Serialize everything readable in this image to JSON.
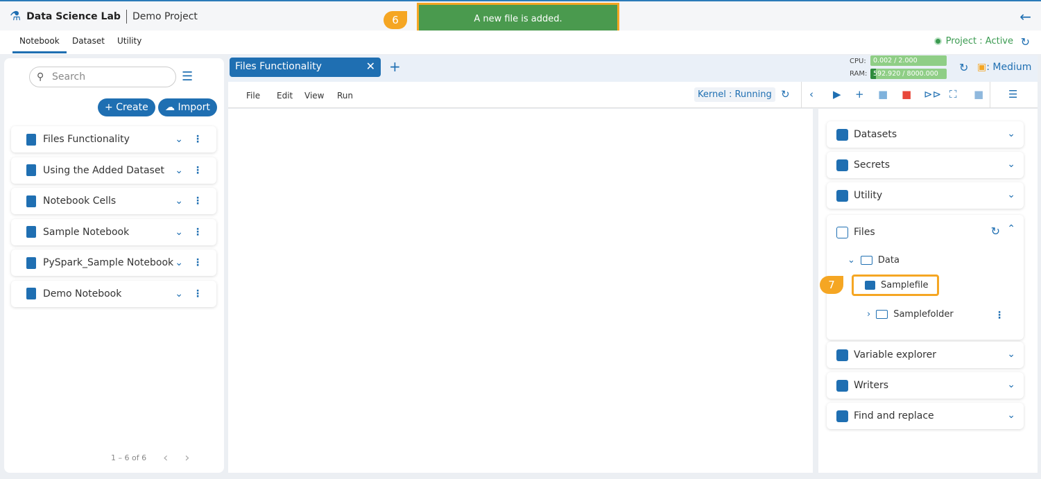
{
  "header": {
    "app": "Data Science Lab",
    "project": "Demo Project"
  },
  "nav": {
    "tabs": [
      "Notebook",
      "Dataset",
      "Utility"
    ],
    "status": "Project : Active"
  },
  "toast": {
    "message": "A new file is added.",
    "step": "6"
  },
  "sidebar": {
    "search_placeholder": "Search",
    "create": "Create",
    "import": "Import",
    "notebooks": [
      "Files Functionality",
      "Using the Added Dataset",
      "Notebook Cells",
      "Sample Notebook",
      "PySpark_Sample Notebook",
      "Demo Notebook"
    ],
    "pagination": "1 – 6 of 6"
  },
  "editor": {
    "tab": "Files Functionality",
    "menu": [
      "File",
      "Edit",
      "View",
      "Run"
    ],
    "kernel": "Kernel : Running",
    "cpu_label": "CPU:",
    "cpu": "0.002 / 2.000",
    "ram_label": "RAM:",
    "ram": "592.920 / 8000.000",
    "ram_fraction": 0.074,
    "size": ": Medium"
  },
  "panel": {
    "sections_top": [
      "Datasets",
      "Secrets",
      "Utility"
    ],
    "files": "Files",
    "folder": "Data",
    "file": "Samplefile",
    "subfolder": "Samplefolder",
    "step": "7",
    "sections_bottom": [
      "Variable explorer",
      "Writers",
      "Find and replace"
    ]
  },
  "colors": {
    "accent": "#1f6fb2",
    "highlight": "#f5a623",
    "toast": "#4a9a4e"
  }
}
